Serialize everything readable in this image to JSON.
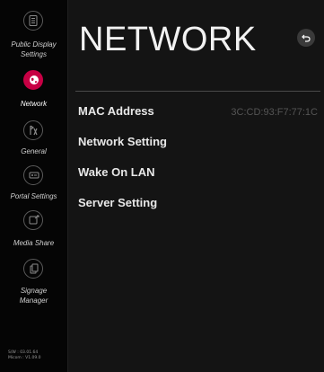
{
  "sidebar": {
    "items": [
      {
        "label_line1": "Public Display",
        "label_line2": "Settings",
        "icon": "public-display-settings-icon",
        "active": false
      },
      {
        "label_line1": "Network",
        "label_line2": "",
        "icon": "network-globe-icon",
        "active": true
      },
      {
        "label_line1": "General",
        "label_line2": "",
        "icon": "general-tools-icon",
        "active": false
      },
      {
        "label_line1": "Portal Settings",
        "label_line2": "",
        "icon": "portal-settings-icon",
        "active": false
      },
      {
        "label_line1": "Media Share",
        "label_line2": "",
        "icon": "media-share-icon",
        "active": false
      },
      {
        "label_line1": "Signage",
        "label_line2": "Manager",
        "icon": "signage-manager-icon",
        "active": false
      }
    ],
    "version": {
      "sw": "S/W : 03.01.64",
      "micom": "Micom : V1.09.0"
    }
  },
  "main": {
    "title": "NETWORK",
    "back_icon": "back-arrow-icon",
    "menu": [
      {
        "label": "MAC Address",
        "value": "3C:CD:93:F7:77:1C"
      },
      {
        "label": "Network Setting",
        "value": ""
      },
      {
        "label": "Wake On LAN",
        "value": ""
      },
      {
        "label": "Server Setting",
        "value": ""
      }
    ]
  },
  "colors": {
    "background": "#141414",
    "sidebar_background": "#050505",
    "accent": "#c70044",
    "text": "#e8e8e8",
    "muted_value": "#555555"
  }
}
